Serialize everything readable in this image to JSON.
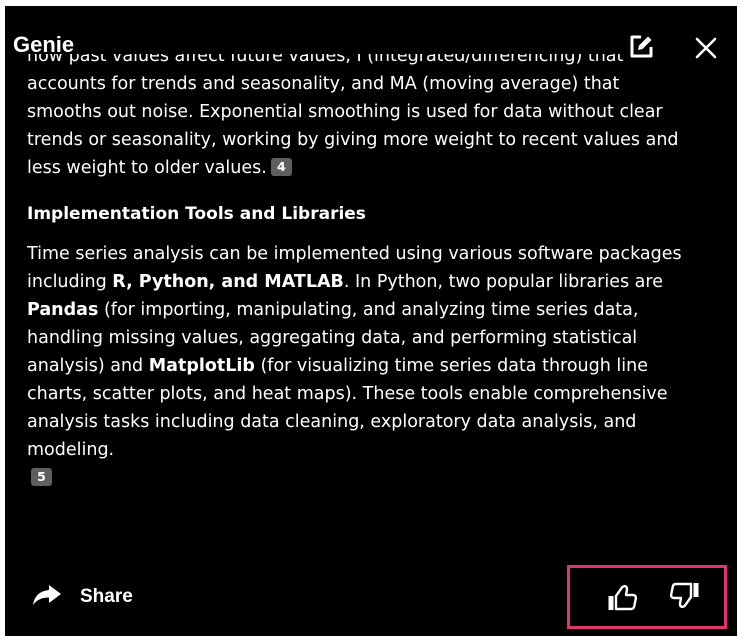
{
  "header": {
    "title": "Genie",
    "edit_icon": "edit-icon",
    "close_icon": "close-icon"
  },
  "content": {
    "cut_line": "how past values affect future values, I (integrated/differencing) that",
    "para1": "accounts for trends and seasonality, and MA (moving average) that smooths out noise. Exponential smoothing is used for data without clear trends or seasonality, working by giving more weight to recent values and less weight to older values.",
    "para1_badge": "4",
    "heading": "Implementation Tools and Libraries",
    "p2_a": "Time series analysis can be implemented using various software packages including ",
    "p2_b": "R, Python, and MATLAB",
    "p2_c": ". In Python, two popular libraries are ",
    "p2_d": "Pandas",
    "p2_e": " (for importing, manipulating, and analyzing time series data, handling missing values, aggregating data, and performing statistical analysis) and ",
    "p2_f": "MatplotLib",
    "p2_g": " (for visualizing time series data through line charts, scatter plots, and heat maps). These tools enable comprehensive analysis tasks including data cleaning, exploratory data analysis, and modeling.",
    "para2_badge": "5"
  },
  "footer": {
    "share_label": "Share",
    "share_icon": "share-arrow-icon",
    "thumbs_up_icon": "thumbs-up-icon",
    "thumbs_down_icon": "thumbs-down-icon",
    "highlight_color": "#e0336f"
  }
}
